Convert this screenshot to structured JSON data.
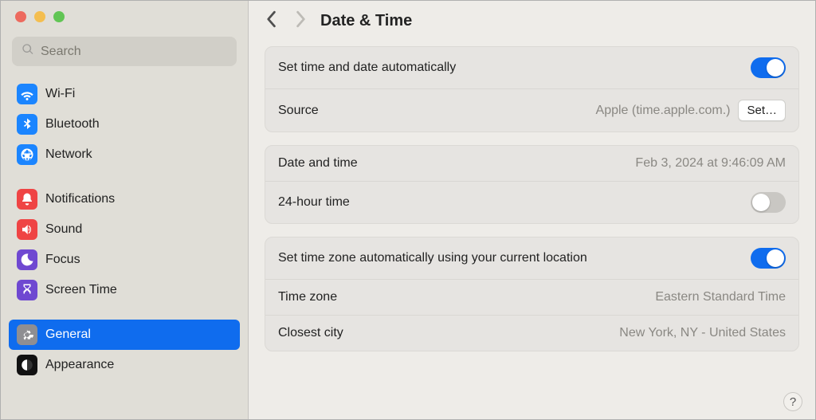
{
  "search": {
    "placeholder": "Search"
  },
  "sidebar": {
    "items": [
      {
        "label": "Wi-Fi"
      },
      {
        "label": "Bluetooth"
      },
      {
        "label": "Network"
      },
      {
        "label": "Notifications"
      },
      {
        "label": "Sound"
      },
      {
        "label": "Focus"
      },
      {
        "label": "Screen Time"
      },
      {
        "label": "General"
      },
      {
        "label": "Appearance"
      }
    ]
  },
  "header": {
    "title": "Date & Time"
  },
  "main": {
    "auto_time_label": "Set time and date automatically",
    "source_label": "Source",
    "source_value": "Apple (time.apple.com.)",
    "set_button": "Set…",
    "date_time_label": "Date and time",
    "date_time_value": "Feb 3, 2024 at 9:46:09 AM",
    "h24_label": "24-hour time",
    "auto_tz_label": "Set time zone automatically using your current location",
    "tz_label": "Time zone",
    "tz_value": "Eastern Standard Time",
    "city_label": "Closest city",
    "city_value": "New York, NY - United States"
  },
  "help": "?"
}
